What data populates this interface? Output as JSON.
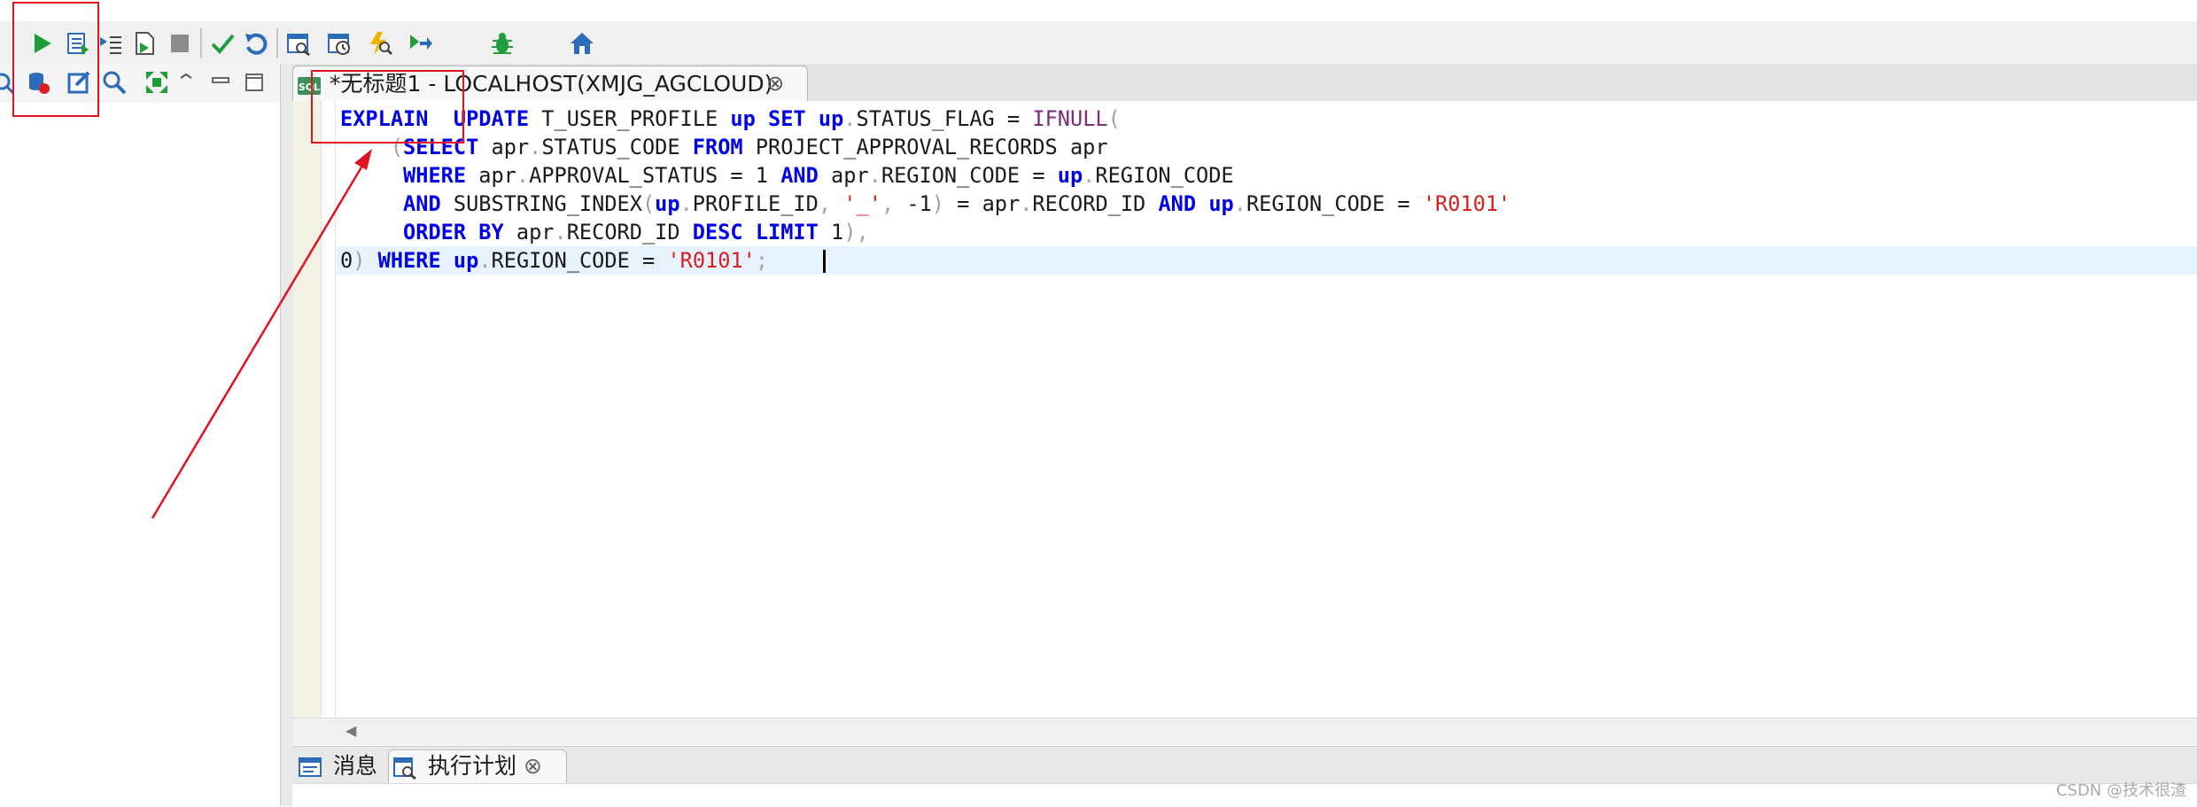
{
  "toolbar": {
    "icons": [
      "run-icon",
      "run-current-icon",
      "step-icon",
      "run-script-icon",
      "stop-icon",
      "commit-icon",
      "rollback-icon",
      "explain-plan-icon",
      "schedule-icon",
      "optimize-icon",
      "run-to-icon",
      "debug-icon",
      "home-icon"
    ]
  },
  "left_toolbar": {
    "icons": [
      "connect-icon",
      "edit-icon",
      "search-icon",
      "expand-icon",
      "collapse-icon",
      "minimize-icon",
      "maximize-icon"
    ]
  },
  "editor": {
    "tab_title": "*无标题1 - LOCALHOST(XMJG_AGCLOUD)",
    "tab_close": "⊗",
    "lines": [
      [
        {
          "t": "EXPLAIN",
          "c": "kw"
        },
        {
          "t": "  ",
          "c": ""
        },
        {
          "t": "UPDATE",
          "c": "kw"
        },
        {
          "t": " T_USER_PROFILE ",
          "c": ""
        },
        {
          "t": "up",
          "c": "kw"
        },
        {
          "t": " ",
          "c": ""
        },
        {
          "t": "SET",
          "c": "kw"
        },
        {
          "t": " ",
          "c": ""
        },
        {
          "t": "up",
          "c": "kw"
        },
        {
          "t": ".",
          "c": "pun"
        },
        {
          "t": "STATUS_FLAG = ",
          "c": ""
        },
        {
          "t": "IFNULL",
          "c": "fn"
        },
        {
          "t": "(",
          "c": "pun"
        }
      ],
      [
        {
          "t": "    ",
          "c": ""
        },
        {
          "t": "(",
          "c": "pun"
        },
        {
          "t": "SELECT",
          "c": "kw"
        },
        {
          "t": " apr",
          "c": ""
        },
        {
          "t": ".",
          "c": "pun"
        },
        {
          "t": "STATUS_CODE ",
          "c": ""
        },
        {
          "t": "FROM",
          "c": "kw"
        },
        {
          "t": " PROJECT_APPROVAL_RECORDS apr",
          "c": ""
        }
      ],
      [
        {
          "t": "     ",
          "c": ""
        },
        {
          "t": "WHERE",
          "c": "kw"
        },
        {
          "t": " apr",
          "c": ""
        },
        {
          "t": ".",
          "c": "pun"
        },
        {
          "t": "APPROVAL_STATUS = 1 ",
          "c": ""
        },
        {
          "t": "AND",
          "c": "kw"
        },
        {
          "t": " apr",
          "c": ""
        },
        {
          "t": ".",
          "c": "pun"
        },
        {
          "t": "REGION_CODE = ",
          "c": ""
        },
        {
          "t": "up",
          "c": "kw"
        },
        {
          "t": ".",
          "c": "pun"
        },
        {
          "t": "REGION_CODE",
          "c": ""
        }
      ],
      [
        {
          "t": "     ",
          "c": ""
        },
        {
          "t": "AND",
          "c": "kw"
        },
        {
          "t": " SUBSTRING_INDEX",
          "c": ""
        },
        {
          "t": "(",
          "c": "pun"
        },
        {
          "t": "up",
          "c": "kw"
        },
        {
          "t": ".",
          "c": "pun"
        },
        {
          "t": "PROFILE_ID",
          "c": ""
        },
        {
          "t": ",",
          "c": "pun"
        },
        {
          "t": " ",
          "c": ""
        },
        {
          "t": "'_'",
          "c": "str"
        },
        {
          "t": ",",
          "c": "pun"
        },
        {
          "t": " -1",
          "c": ""
        },
        {
          "t": ")",
          "c": "pun"
        },
        {
          "t": " = apr",
          "c": ""
        },
        {
          "t": ".",
          "c": "pun"
        },
        {
          "t": "RECORD_ID ",
          "c": ""
        },
        {
          "t": "AND",
          "c": "kw"
        },
        {
          "t": " ",
          "c": ""
        },
        {
          "t": "up",
          "c": "kw"
        },
        {
          "t": ".",
          "c": "pun"
        },
        {
          "t": "REGION_CODE = ",
          "c": ""
        },
        {
          "t": "'R0101'",
          "c": "str"
        }
      ],
      [
        {
          "t": "     ",
          "c": ""
        },
        {
          "t": "ORDER BY",
          "c": "kw"
        },
        {
          "t": " apr",
          "c": ""
        },
        {
          "t": ".",
          "c": "pun"
        },
        {
          "t": "RECORD_ID ",
          "c": ""
        },
        {
          "t": "DESC",
          "c": "kw"
        },
        {
          "t": " ",
          "c": ""
        },
        {
          "t": "LIMIT",
          "c": "kw"
        },
        {
          "t": " 1",
          "c": ""
        },
        {
          "t": "),",
          "c": "pun"
        }
      ],
      [
        {
          "t": "0",
          "c": ""
        },
        {
          "t": ")",
          "c": "pun"
        },
        {
          "t": " ",
          "c": ""
        },
        {
          "t": "WHERE",
          "c": "kw"
        },
        {
          "t": " ",
          "c": ""
        },
        {
          "t": "up",
          "c": "kw"
        },
        {
          "t": ".",
          "c": "pun"
        },
        {
          "t": "REGION_CODE = ",
          "c": ""
        },
        {
          "t": "'R0101'",
          "c": "str"
        },
        {
          "t": ";",
          "c": "pun"
        }
      ]
    ]
  },
  "bottom_tabs": {
    "messages": "消息",
    "plan": "执行计划",
    "plan_close": "⊗"
  },
  "watermark": "CSDN @技术很渣",
  "colors": {
    "keyword": "#0000e6",
    "function": "#7a2c7a",
    "string": "#d81e1e",
    "annotation": "#e0141e"
  }
}
